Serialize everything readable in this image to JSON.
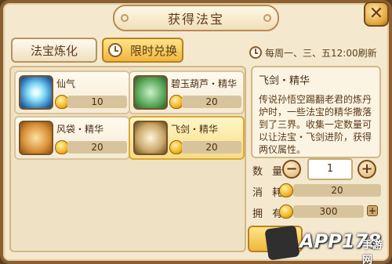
{
  "window": {
    "title": "获得法宝",
    "close_glyph": "✕"
  },
  "tabs": [
    {
      "label": "法宝炼化",
      "active": false
    },
    {
      "label": "限时兑换",
      "active": true,
      "icon": "clock-icon"
    }
  ],
  "refresh_note": "每周一、三、五12:00刷新",
  "items": [
    {
      "name": "仙气",
      "price": "10",
      "icon": "spirit-orb-icon",
      "selected": false
    },
    {
      "name": "碧玉葫芦・精华",
      "price": "20",
      "icon": "jade-gourd-icon",
      "selected": false
    },
    {
      "name": "风袋・精华",
      "price": "20",
      "icon": "wind-bag-icon",
      "selected": false
    },
    {
      "name": "飞剑・精华",
      "price": "20",
      "icon": "flying-sword-icon",
      "selected": true
    }
  ],
  "detail": {
    "title": "飞剑・精华",
    "description": "传说孙悟空踢翻老君的炼丹炉时，一些法宝的精华撒落到了三界。收集一定数量可以让法宝・飞剑进阶，获得两仪属性。"
  },
  "purchase": {
    "quantity_label": "数 量",
    "quantity": "1",
    "cost_label": "消 耗",
    "cost": "20",
    "owned_label": "拥 有",
    "owned": "300",
    "minus_glyph": "−",
    "plus_glyph": "+",
    "add_glyph": "+"
  },
  "watermark": {
    "text": "APP178",
    "sub": "手游网"
  },
  "colors": {
    "accent": "#f0b63c",
    "frame": "#8a5f34",
    "panel": "#f4e9cf"
  }
}
